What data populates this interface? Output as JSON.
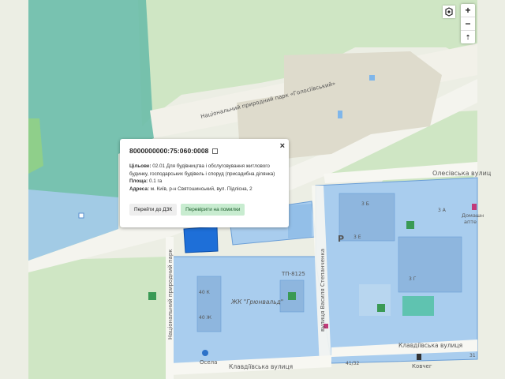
{
  "map": {
    "labels": {
      "park_road": "Національний природний парк «Голосіївський»",
      "park_road_vertical": "Національний природний парк",
      "olesivska": "Олесівська вулиц",
      "klavdiivska_right": "Клавдіївська вулиця",
      "klavdiivska_bottom": "Клавдіївська вулиця",
      "vasyl_street": "вулиця Василя Степанченка",
      "complex": "ЖК \"Грюнвальд\"",
      "tp": "ТП-8125",
      "bldg_40k": "40 К",
      "bldg_40": "40 Ж",
      "bldg_3b": "3 Б",
      "bldg_3e": "3 Е",
      "bldg_3a": "3 А",
      "bldg_3g": "3 Г",
      "osela": "Осела",
      "kovcheg": "Ковчег",
      "domashnya": "Домашн",
      "apteka": "апте",
      "num_41_32": "41/32",
      "num_31": "31",
      "parking": "P"
    },
    "colors": {
      "park_green": "#cfe6c4",
      "cadastre_blue": "#a9cdee",
      "selected_parcel": "#1e6fd8",
      "teal_zone": "#5fb8a8"
    }
  },
  "popup": {
    "parcel_id": "8000000000:75:060:0008",
    "close": "×",
    "purpose_label": "Цільове:",
    "purpose_value": "02.01 Для будівництва і обслуговування житлового будинку, господарських будівель і споруд (присадибна ділянка)",
    "area_label": "Площа:",
    "area_value": "0.1 га",
    "address_label": "Адреса:",
    "address_value": "м. Київ, р-н Святошинський, вул. Підлісна, 2",
    "btn_dzk": "Перейти до ДЗК",
    "btn_check": "Перевірити на помилки"
  },
  "controls": {
    "zoom_in": "+",
    "zoom_out": "−",
    "north": "⇡"
  }
}
